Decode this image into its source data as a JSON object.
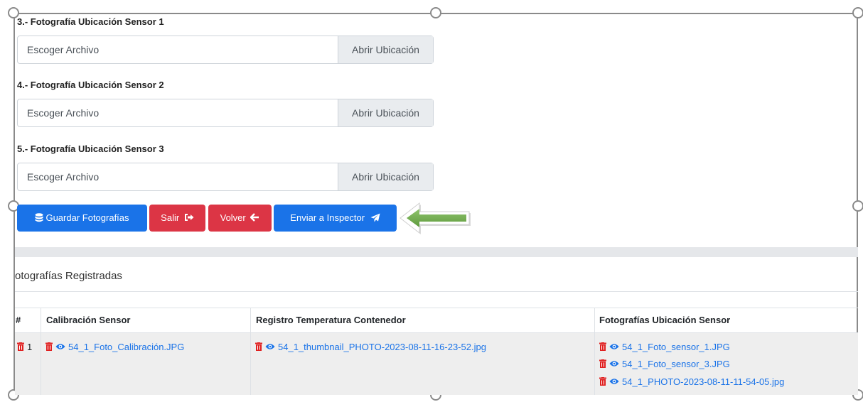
{
  "form": {
    "fields": [
      {
        "label": "3.- Fotografía Ubicación Sensor 1",
        "placeholder": "Escoger Archivo",
        "button": "Abrir Ubicación"
      },
      {
        "label": "4.- Fotografía Ubicación Sensor 2",
        "placeholder": "Escoger Archivo",
        "button": "Abrir Ubicación"
      },
      {
        "label": "5.- Fotografía Ubicación Sensor 3",
        "placeholder": "Escoger Archivo",
        "button": "Abrir Ubicación"
      }
    ]
  },
  "actions": {
    "save": "Guardar Fotografías",
    "exit": "Salir",
    "back": "Volver",
    "send": "Enviar a Inspector"
  },
  "colors": {
    "primary": "#1a73e8",
    "danger": "#dc3545",
    "arrow": "#6aa84f"
  },
  "registered": {
    "title": "otografías Registradas",
    "columns": [
      "#",
      "Calibración Sensor",
      "Registro Temperatura Contenedor",
      "Fotografías Ubicación Sensor"
    ],
    "rows": [
      {
        "num": "1",
        "calibracion": [
          "54_1_Foto_Calibración.JPG"
        ],
        "temperatura": [
          "54_1_thumbnail_PHOTO-2023-08-11-16-23-52.jpg"
        ],
        "ubicacion": [
          "54_1_Foto_sensor_1.JPG",
          "54_1_Foto_sensor_3.JPG",
          "54_1_PHOTO-2023-08-11-11-54-05.jpg"
        ]
      }
    ]
  }
}
